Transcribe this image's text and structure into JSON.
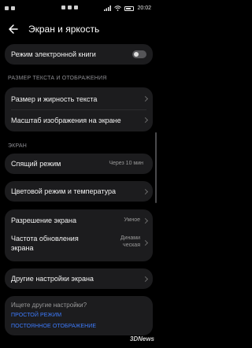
{
  "status_bar": {
    "time": "20:02",
    "battery_icon": "battery-icon",
    "wifi_icon": "wifi-icon",
    "signal_icon": "signal-icon"
  },
  "header": {
    "title": "Экран и яркость",
    "back_icon": "back-arrow-icon"
  },
  "ebook": {
    "label": "Режим электронной книги",
    "toggle_on": false
  },
  "text_display_section": {
    "heading": "РАЗМЕР ТЕКСТА И ОТОБРАЖЕНИЯ",
    "items": [
      {
        "label": "Размер и жирность текста"
      },
      {
        "label": "Масштаб изображения на экране"
      }
    ]
  },
  "screen_section": {
    "heading": "ЭКРАН",
    "sleep": {
      "label": "Спящий режим",
      "value": "Через 10 мин"
    },
    "color": {
      "label": "Цветовой режим и температура"
    },
    "resolution": {
      "label": "Разрешение экрана",
      "value": "Умное"
    },
    "refresh": {
      "label_line1": "Частота обновления",
      "label_line2": "экрана",
      "value_line1": "Динами",
      "value_line2": "ческая"
    },
    "other": {
      "label": "Другие настройки экрана"
    }
  },
  "suggestions": {
    "question": "Ищете другие настройки?",
    "links": [
      {
        "label": "ПРОСТОЙ РЕЖИМ"
      },
      {
        "label": "ПОСТОЯННОЕ ОТОБРАЖЕНИЕ"
      }
    ]
  },
  "watermark": "3DNews",
  "colors": {
    "background": "#000000",
    "card": "#1c1c1e",
    "link": "#3d7cff",
    "secondary_text": "#8e8e93"
  }
}
